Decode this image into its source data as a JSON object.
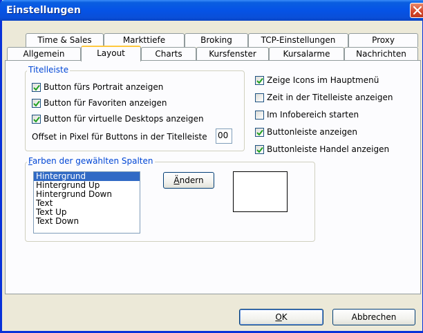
{
  "window": {
    "title": "Einstellungen"
  },
  "tabs": {
    "row1": [
      "Time & Sales",
      "Markttiefe",
      "Broking",
      "TCP-Einstellungen",
      "Proxy"
    ],
    "row2": [
      "Allgemein",
      "Layout",
      "Charts",
      "Kursfenster",
      "Kursalarme",
      "Nachrichten"
    ],
    "active": "Layout"
  },
  "titlebar_group": {
    "legend": "Titelleiste",
    "options": [
      {
        "label": "Button fürs Portrait anzeigen",
        "checked": true
      },
      {
        "label": "Button für Favoriten anzeigen",
        "checked": true
      },
      {
        "label": "Button für virtuelle Desktops anzeigen",
        "checked": true
      }
    ],
    "offset_label": "Offset in Pixel für Buttons in der Titelleiste",
    "offset_value": "00"
  },
  "right_options": [
    {
      "label": "Zeige Icons im Hauptmenü",
      "checked": true
    },
    {
      "label": "Zeit in der Titelleiste anzeigen",
      "checked": false
    },
    {
      "label": "Im Infobereich starten",
      "checked": false
    },
    {
      "label": "Buttonleiste anzeigen",
      "checked": true
    },
    {
      "label": "Buttonleiste Handel anzeigen",
      "checked": true
    }
  ],
  "colors_group": {
    "legend_underline": "F",
    "legend_rest": "arben der gewählten Spalten",
    "items": [
      "Hintergrund",
      "Hintergrund Up",
      "Hintergrund Down",
      "Text",
      "Text Up",
      "Text Down"
    ],
    "selected": "Hintergrund",
    "change_button_underline": "Ä",
    "change_button_rest": "ndern",
    "preview_color": "#ffffff"
  },
  "footer": {
    "ok_underline": "O",
    "ok_rest": "K",
    "cancel_label": "Abbrechen"
  }
}
